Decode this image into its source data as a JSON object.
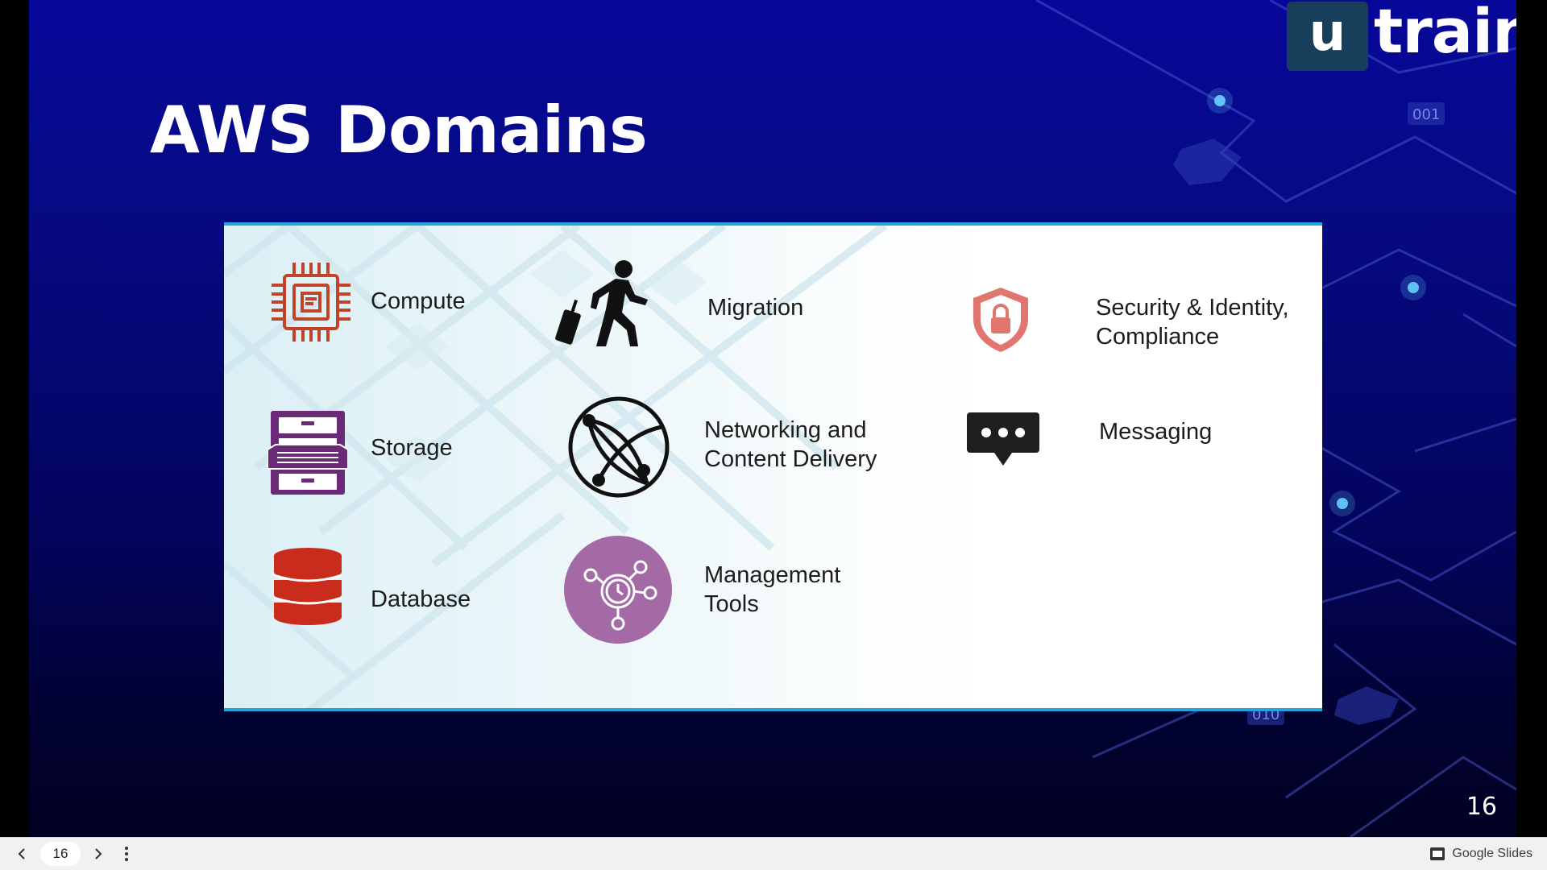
{
  "slide": {
    "title": "AWS Domains",
    "page_number": "16",
    "logo": {
      "box_letter": "u",
      "word": "train"
    },
    "bg_tags": [
      "001",
      "010"
    ]
  },
  "domains": [
    {
      "label": "Compute",
      "icon": "cpu-chip-icon",
      "color": "#c0432a"
    },
    {
      "label": "Storage",
      "icon": "file-cabinet-icon",
      "color": "#6b2a78"
    },
    {
      "label": "Database",
      "icon": "database-icon",
      "color": "#c92c1c"
    },
    {
      "label": "Migration",
      "icon": "traveler-icon",
      "color": "#111111"
    },
    {
      "label": "Networking and\nContent Delivery",
      "icon": "globe-network-icon",
      "color": "#111111"
    },
    {
      "label": "Management\nTools",
      "icon": "management-hub-icon",
      "color": "#a46aa6"
    },
    {
      "label": "Security & Identity,\nCompliance",
      "icon": "shield-lock-icon",
      "color": "#e0766e"
    },
    {
      "label": "Messaging",
      "icon": "chat-bubble-icon",
      "color": "#1e1e1e"
    }
  ],
  "player": {
    "current_page": "16",
    "brand_label": "Google Slides"
  },
  "colors": {
    "accent_line": "#23a4dc",
    "logo_box": "#173f5c"
  }
}
